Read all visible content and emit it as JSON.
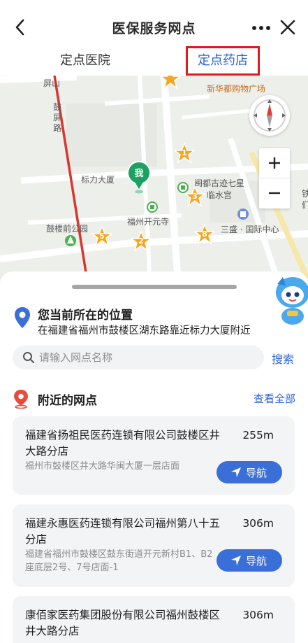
{
  "header": {
    "title": "医保服务网点"
  },
  "tabs": [
    {
      "label": "定点医院",
      "active": false
    },
    {
      "label": "定点药店",
      "active": true
    }
  ],
  "map": {
    "labels": {
      "pingshan": "屏山",
      "guping_road": "鼓屏路",
      "xinhua_mall": "新华都购物广场",
      "biaoli_building": "标力大厦",
      "mindu_site": "闽都古迹七星",
      "linshui_palace": "临水宫",
      "kaiyuan_temple": "福州开元寺",
      "gulouqian_park": "鼓楼前公园",
      "sansheng_center": "三盛 · 国际中心",
      "edge_text": "铁",
      "edge_text2": "们"
    },
    "me_label": "我",
    "markers": [
      "1",
      "2",
      "3",
      "5",
      "8"
    ]
  },
  "location": {
    "title": "您当前所在的位置",
    "address": "在福建省福州市鼓楼区湖东路靠近标力大厦附近"
  },
  "search": {
    "placeholder": "请输入网点名称",
    "button": "搜索"
  },
  "nearby": {
    "title": "附近的网点",
    "view_all": "查看全部",
    "nav_label": "导航",
    "items": [
      {
        "name": "福建省扬祖民医药连锁有限公司鼓楼区井大路分店",
        "distance": "255m",
        "address": "福州市鼓楼区井大路华闽大厦一层店面"
      },
      {
        "name": "福建永惠医药连锁有限公司福州第八十五分店",
        "distance": "306m",
        "address": "福建省福州市鼓楼区鼓东街道开元新村B1、B2座底层2号、7号店面-1"
      },
      {
        "name": "康佰家医药集团股份有限公司福州鼓楼区井大路分店",
        "distance": "306m",
        "address": ""
      }
    ]
  },
  "colors": {
    "accent": "#2c64d9",
    "nav_button": "#3b6fd8",
    "active_tab_border": "#e0191f",
    "star_marker": "#f5a623",
    "me_pin": "#1aa260"
  }
}
